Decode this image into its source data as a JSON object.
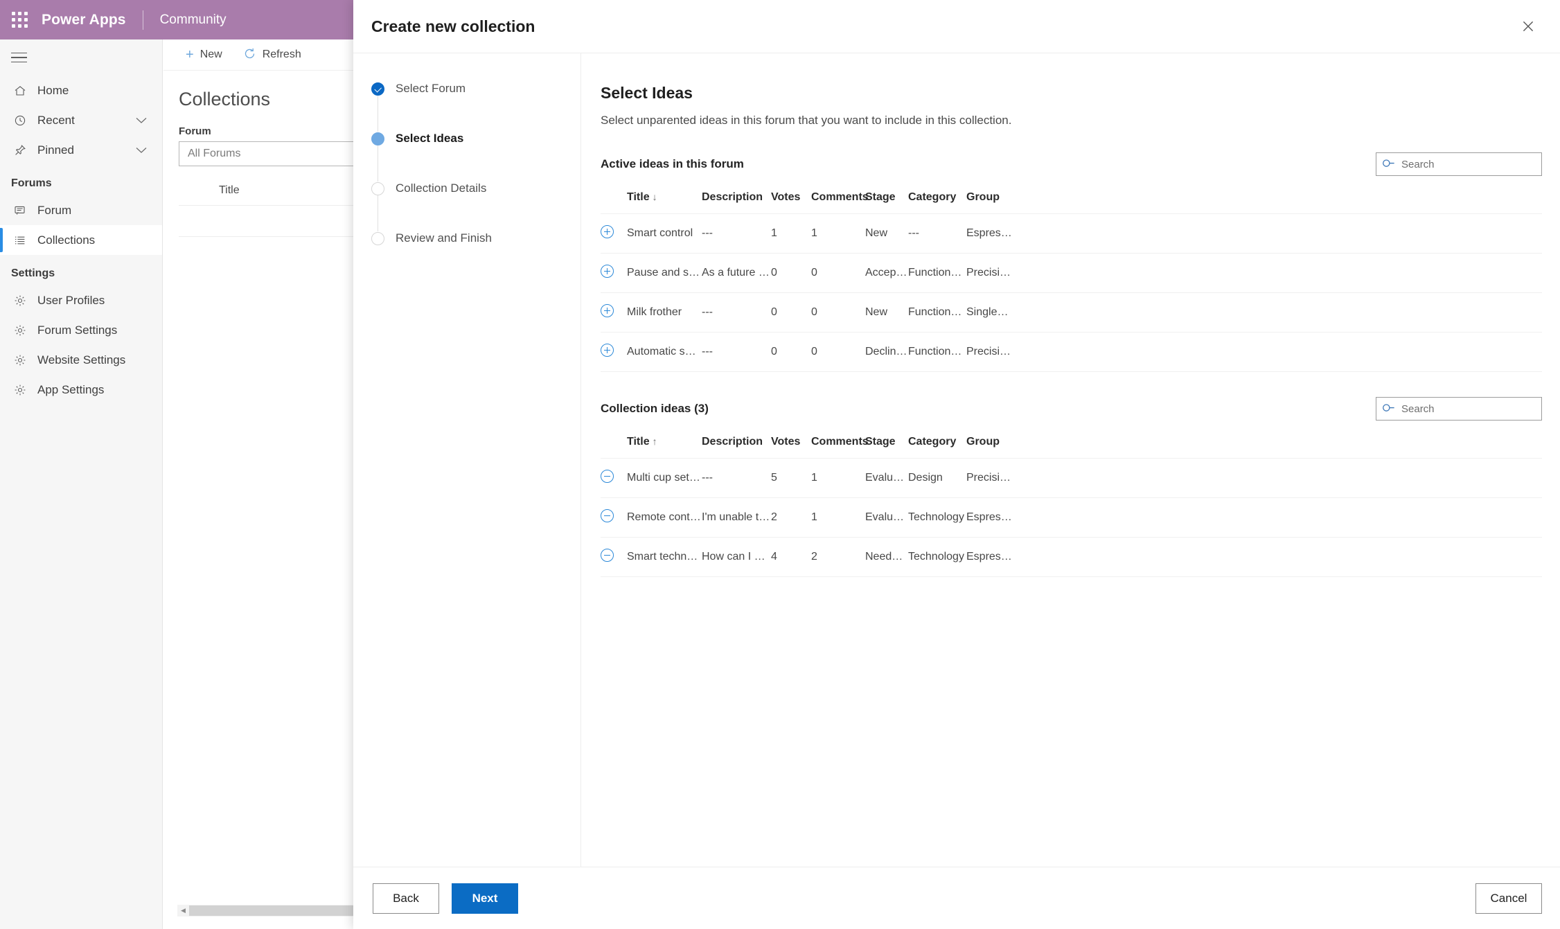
{
  "topbar": {
    "waffle_icon": "app-launcher-icon",
    "brand": "Power Apps",
    "sub_brand": "Community"
  },
  "sidebar": {
    "menu_icon": "hamburger-icon",
    "items": [
      {
        "label": "Home",
        "icon": "home-icon",
        "expandable": false,
        "selected": false
      },
      {
        "label": "Recent",
        "icon": "clock-icon",
        "expandable": true,
        "selected": false
      },
      {
        "label": "Pinned",
        "icon": "pin-icon",
        "expandable": true,
        "selected": false
      }
    ],
    "groups": [
      {
        "label": "Forums",
        "items": [
          {
            "label": "Forum",
            "icon": "forum-icon",
            "selected": false
          },
          {
            "label": "Collections",
            "icon": "list-icon",
            "selected": true
          }
        ]
      },
      {
        "label": "Settings",
        "items": [
          {
            "label": "User Profiles",
            "icon": "gear-icon",
            "selected": false
          },
          {
            "label": "Forum Settings",
            "icon": "gear-icon",
            "selected": false
          },
          {
            "label": "Website Settings",
            "icon": "gear-icon",
            "selected": false
          },
          {
            "label": "App Settings",
            "icon": "gear-icon",
            "selected": false
          }
        ]
      }
    ]
  },
  "background_page": {
    "commands": [
      {
        "label": "New",
        "icon": "plus-icon"
      },
      {
        "label": "Refresh",
        "icon": "refresh-icon"
      }
    ],
    "title": "Collections",
    "forum_label": "Forum",
    "forum_value": "All Forums",
    "table_header_title": "Title",
    "scroll_left_icon": "caret-left-icon"
  },
  "dialog": {
    "title": "Create new collection",
    "close_icon": "close-icon",
    "steps": [
      {
        "label": "Select Forum",
        "state": "done"
      },
      {
        "label": "Select Ideas",
        "state": "current"
      },
      {
        "label": "Collection Details",
        "state": "pending"
      },
      {
        "label": "Review and Finish",
        "state": "pending"
      }
    ],
    "panel": {
      "heading": "Select Ideas",
      "description": "Select unparented ideas in this forum that you want to include in this collection.",
      "active_section": {
        "title": "Active ideas in this forum",
        "search": {
          "placeholder": "Search",
          "value": "",
          "icon": "search-icon"
        },
        "columns": [
          "Title",
          "Description",
          "Votes",
          "Comments",
          "Stage",
          "Category",
          "Group"
        ],
        "sort_column": "Title",
        "sort_direction": "↓",
        "row_action_icon": "add-circle-icon",
        "rows": [
          {
            "title": "Smart control",
            "description": "---",
            "votes": "1",
            "comments": "1",
            "stage": "New",
            "category": "---",
            "group": "Espres…"
          },
          {
            "title": "Pause and serve",
            "description": "As a future fea…",
            "votes": "0",
            "comments": "0",
            "stage": "Accep…",
            "category": "Functional…",
            "group": "Precisi…"
          },
          {
            "title": "Milk frother",
            "description": "---",
            "votes": "0",
            "comments": "0",
            "stage": "New",
            "category": "Functional…",
            "group": "Single…"
          },
          {
            "title": "Automatic shu…",
            "description": "---",
            "votes": "0",
            "comments": "0",
            "stage": "Declin…",
            "category": "Functional…",
            "group": "Precisi…"
          }
        ]
      },
      "collection_section": {
        "title": "Collection ideas (3)",
        "count": 3,
        "search": {
          "placeholder": "Search",
          "value": "",
          "icon": "search-icon"
        },
        "columns": [
          "Title",
          "Description",
          "Votes",
          "Comments",
          "Stage",
          "Category",
          "Group"
        ],
        "sort_column": "Title",
        "sort_direction": "↑",
        "row_action_icon": "remove-circle-icon",
        "rows": [
          {
            "title": "Multi cup setti…",
            "description": "---",
            "votes": "5",
            "comments": "1",
            "stage": "Evalua…",
            "category": "Design",
            "group": "Precisi…"
          },
          {
            "title": "Remote control",
            "description": "I'm unable to …",
            "votes": "2",
            "comments": "1",
            "stage": "Evalua…",
            "category": "Technology",
            "group": "Espres…"
          },
          {
            "title": "Smart technol…",
            "description": "How can I bre…",
            "votes": "4",
            "comments": "2",
            "stage": "Needs…",
            "category": "Technology",
            "group": "Espres…"
          }
        ]
      }
    },
    "footer": {
      "back_label": "Back",
      "next_label": "Next",
      "cancel_label": "Cancel"
    }
  },
  "colors": {
    "brand_purple": "#a97cab",
    "accent_blue": "#0b6cc4",
    "link_blue": "#2b88d8",
    "step_current": "#6fa9e2",
    "sidebar_bg": "#f6f6f6"
  }
}
